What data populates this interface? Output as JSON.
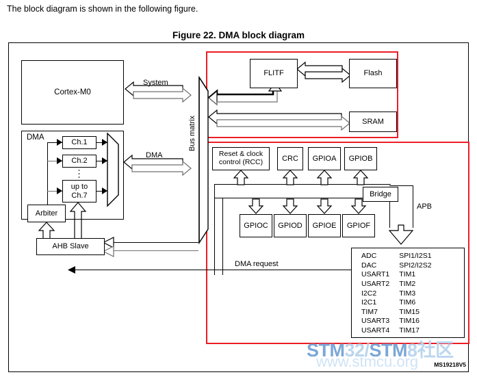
{
  "page": {
    "intro_text": "The block diagram is shown in the following figure.",
    "figure_title": "Figure 22. DMA block diagram",
    "figure_id": "MS19218V5"
  },
  "blocks": {
    "cortex": "Cortex-M0",
    "dma_group": "DMA",
    "ch1": "Ch.1",
    "ch2": "Ch.2",
    "ch7": "up to\nCh.7",
    "ch7_line1": "up to",
    "ch7_line2": "Ch.7",
    "arbiter": "Arbiter",
    "ahb_slave": "AHB Slave",
    "bus_matrix": "Bus matrix",
    "flitf": "FLITF",
    "flash": "Flash",
    "sram": "SRAM",
    "bridge": "Bridge"
  },
  "connections": {
    "system": "System",
    "dma": "DMA",
    "dma_request": "DMA request",
    "apb": "APB"
  },
  "peripherals_row1": [
    {
      "name": "Reset & clock control (RCC)",
      "line1": "Reset & clock",
      "line2": "control (RCC)"
    },
    {
      "name": "CRC",
      "line1": "CRC",
      "line2": ""
    },
    {
      "name": "GPIOA",
      "line1": "GPIOA",
      "line2": ""
    },
    {
      "name": "GPIOB",
      "line1": "GPIOB",
      "line2": ""
    }
  ],
  "peripherals_row2": [
    {
      "name": "GPIOC"
    },
    {
      "name": "GPIOD"
    },
    {
      "name": "GPIOE"
    },
    {
      "name": "GPIOF"
    }
  ],
  "apb_peripheral_list": {
    "column_left": [
      "ADC",
      "DAC",
      "USART1",
      "USART2",
      "I2C2",
      "I2C1",
      "TIM7",
      "USART3",
      "USART4"
    ],
    "column_right": [
      "SPI1/I2S1",
      "SPI2/I2S2",
      "TIM1",
      "TIM2",
      "TIM3",
      "TIM6",
      "TIM15",
      "TIM16",
      "TIM17"
    ]
  },
  "watermark": {
    "line1_bold": "STM",
    "line1_light": "32/",
    "line1_bold2": "STM",
    "line1_light2": "8社区",
    "line2": "www.stmcu.org"
  },
  "colors": {
    "highlight_red": "#ED1C24",
    "stroke": "#000000",
    "watermark_blue": "#7BA7D7",
    "watermark_light": "#CFE3F5"
  }
}
